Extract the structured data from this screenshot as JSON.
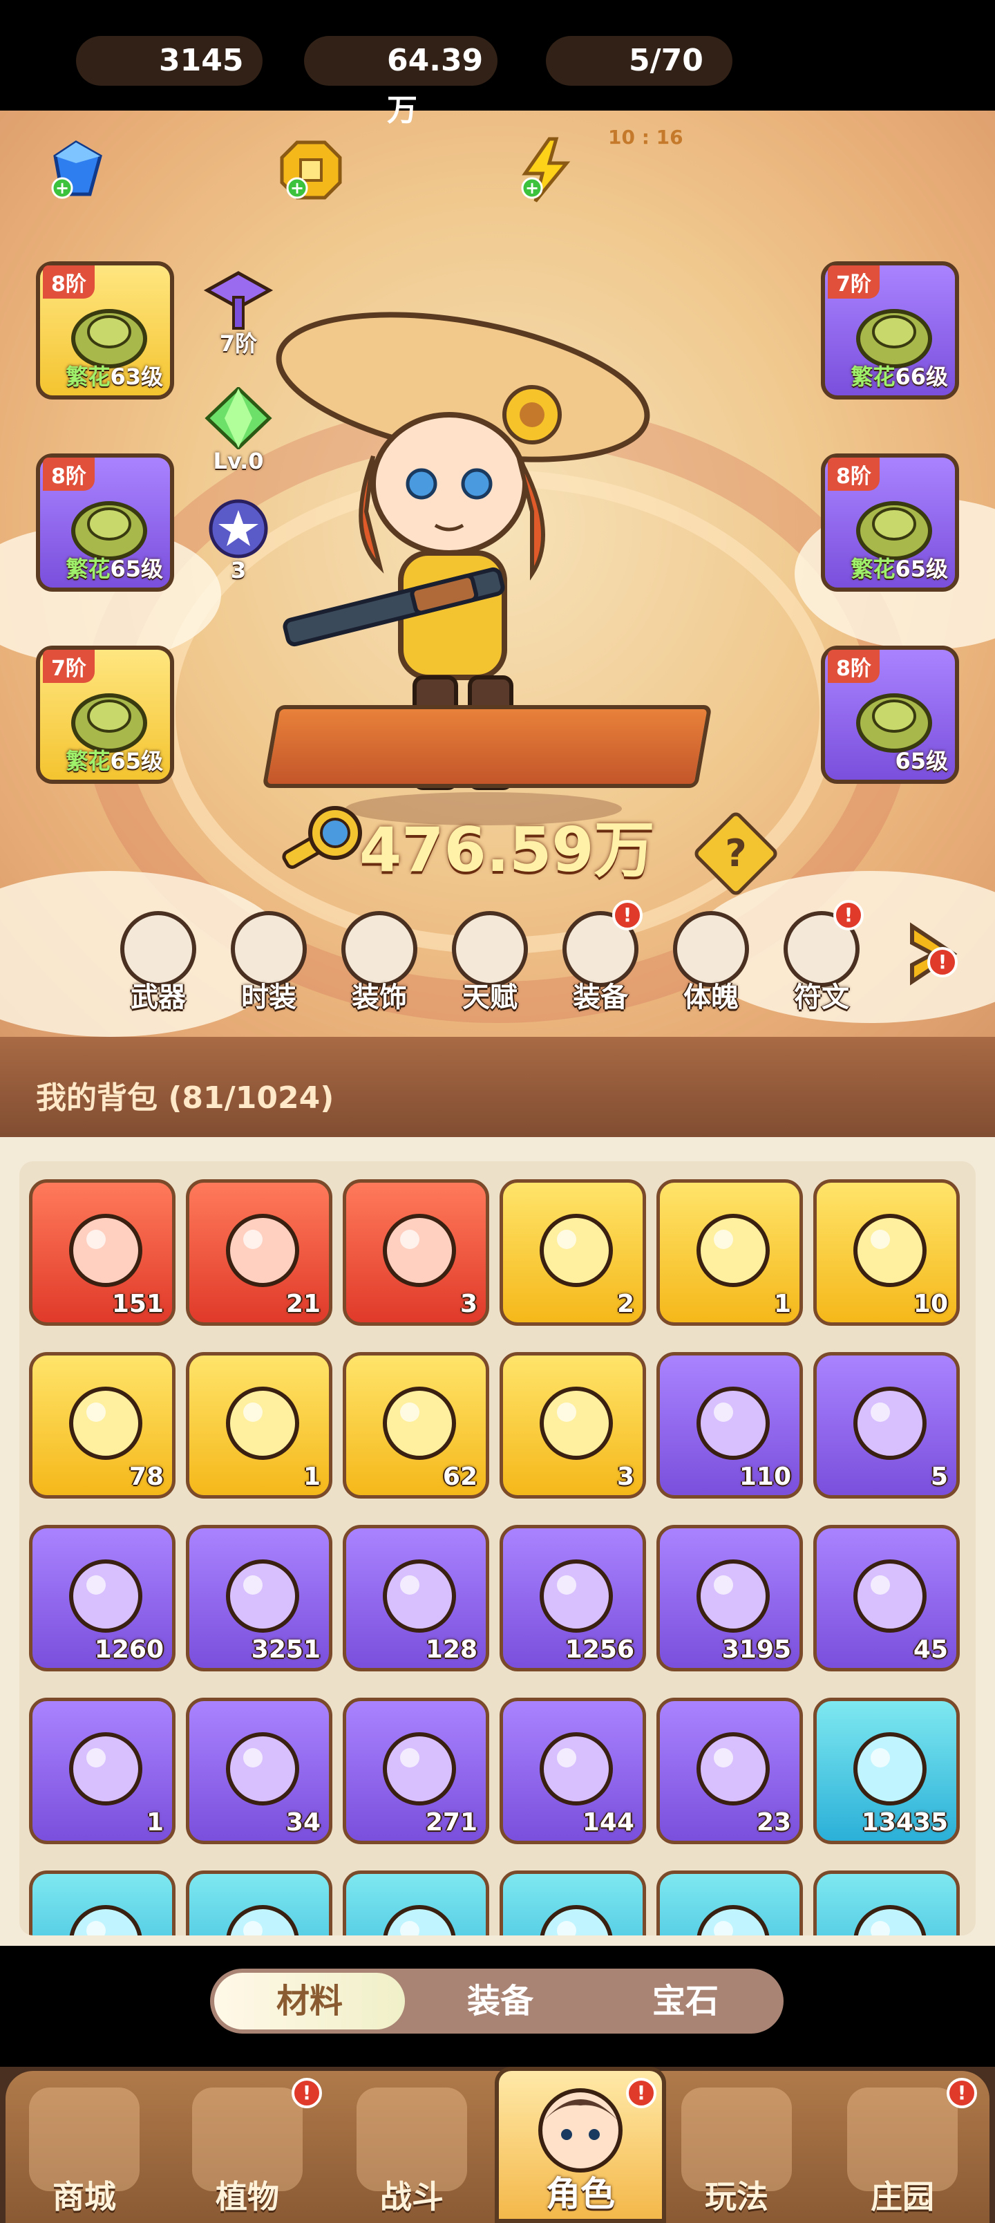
{
  "resources": {
    "diamonds": "3145",
    "gold": "64.39万",
    "energy": "5/70",
    "energy_timer": "10 : 16"
  },
  "equip_left": [
    {
      "tier": "8阶",
      "prefix": "繁花",
      "level": "63级",
      "color": "gold",
      "icon": "hat-icon"
    },
    {
      "tier": "8阶",
      "prefix": "繁花",
      "level": "65级",
      "color": "purple",
      "icon": "gloves-icon"
    },
    {
      "tier": "7阶",
      "prefix": "繁花",
      "level": "65级",
      "color": "gold",
      "icon": "pants-icon"
    }
  ],
  "equip_right": [
    {
      "tier": "7阶",
      "prefix": "繁花",
      "level": "66级",
      "color": "purple",
      "icon": "shirt-icon"
    },
    {
      "tier": "8阶",
      "prefix": "繁花",
      "level": "65级",
      "color": "purple",
      "icon": "belt-icon"
    },
    {
      "tier": "8阶",
      "prefix": "",
      "level": "65级",
      "color": "purple",
      "icon": "boots-icon"
    }
  ],
  "mini_items": [
    {
      "label": "7阶",
      "icon": "purple-hammer-icon"
    },
    {
      "label": "Lv.0",
      "icon": "green-gem-icon"
    },
    {
      "label": "3",
      "icon": "star-orb-icon"
    }
  ],
  "power": "476.59万",
  "help_label": "?",
  "functions": [
    {
      "label": "武器",
      "badge": false
    },
    {
      "label": "时装",
      "badge": false
    },
    {
      "label": "装饰",
      "badge": false
    },
    {
      "label": "天赋",
      "badge": false
    },
    {
      "label": "装备",
      "badge": true
    },
    {
      "label": "体魄",
      "badge": false
    },
    {
      "label": "符文",
      "badge": true
    }
  ],
  "badge_mark": "!",
  "bag_title": "我的背包 (81/1024)",
  "bag_items": [
    {
      "count": "151",
      "color": "red",
      "icon": "blue-star-crystal-icon"
    },
    {
      "count": "21",
      "color": "red",
      "icon": "red-potion-icon"
    },
    {
      "count": "3",
      "color": "red",
      "icon": "green-capsule-icon"
    },
    {
      "count": "2",
      "color": "gold",
      "icon": "golden-key-icon"
    },
    {
      "count": "1",
      "color": "gold",
      "icon": "rune-stone-icon"
    },
    {
      "count": "10",
      "color": "gold",
      "icon": "orange-potion-icon"
    },
    {
      "count": "78",
      "color": "gold",
      "icon": "golden-pyramid-icon"
    },
    {
      "count": "1",
      "color": "gold",
      "icon": "flower-pot-icon"
    },
    {
      "count": "62",
      "color": "gold",
      "icon": "purple-book-icon"
    },
    {
      "count": "3",
      "color": "gold",
      "icon": "orange-ore-icon"
    },
    {
      "count": "110",
      "color": "purple",
      "icon": "purple-flask-icon"
    },
    {
      "count": "5",
      "color": "purple",
      "icon": "blue-leaf-icon"
    },
    {
      "count": "1260",
      "color": "purple",
      "icon": "green-scroll-icon"
    },
    {
      "count": "3251",
      "color": "purple",
      "icon": "purple-scroll-icon"
    },
    {
      "count": "128",
      "color": "purple",
      "icon": "blue-scroll-icon"
    },
    {
      "count": "1256",
      "color": "purple",
      "icon": "red-scroll-icon"
    },
    {
      "count": "3195",
      "color": "purple",
      "icon": "yellow-scroll-icon"
    },
    {
      "count": "45",
      "color": "purple",
      "icon": "purple-potion-icon"
    },
    {
      "count": "1",
      "color": "purple",
      "icon": "fruit-bowl-icon"
    },
    {
      "count": "34",
      "color": "purple",
      "icon": "golden-drop-icon"
    },
    {
      "count": "271",
      "color": "purple",
      "icon": "purple-crystal-icon"
    },
    {
      "count": "144",
      "color": "purple",
      "icon": "purple-crystal-icon"
    },
    {
      "count": "23",
      "color": "purple",
      "icon": "triquetra-icon"
    },
    {
      "count": "13435",
      "color": "cyan",
      "icon": "green-orb-icon"
    },
    {
      "count": "",
      "color": "cyan",
      "icon": "purple-seed-icon"
    },
    {
      "count": "",
      "color": "cyan",
      "icon": "blue-seed-icon"
    },
    {
      "count": "",
      "color": "cyan",
      "icon": "orange-seed-icon"
    },
    {
      "count": "",
      "color": "cyan",
      "icon": "yellow-seed-icon"
    },
    {
      "count": "",
      "color": "cyan",
      "icon": "blue-potion-icon"
    },
    {
      "count": "",
      "color": "cyan",
      "icon": "map-scroll-icon"
    }
  ],
  "tabs": [
    "材料",
    "装备",
    "宝石"
  ],
  "nav": [
    {
      "label": "商城",
      "badge": false
    },
    {
      "label": "植物",
      "badge": true
    },
    {
      "label": "战斗",
      "badge": false
    },
    {
      "label": "角色",
      "badge": true
    },
    {
      "label": "玩法",
      "badge": false
    },
    {
      "label": "庄园",
      "badge": true
    }
  ],
  "colors": {
    "red": "#e03a2a",
    "gold": "#f5b81a",
    "purple": "#7a4fdc",
    "cyan": "#2bb0d8",
    "accent": "#c4562a"
  }
}
